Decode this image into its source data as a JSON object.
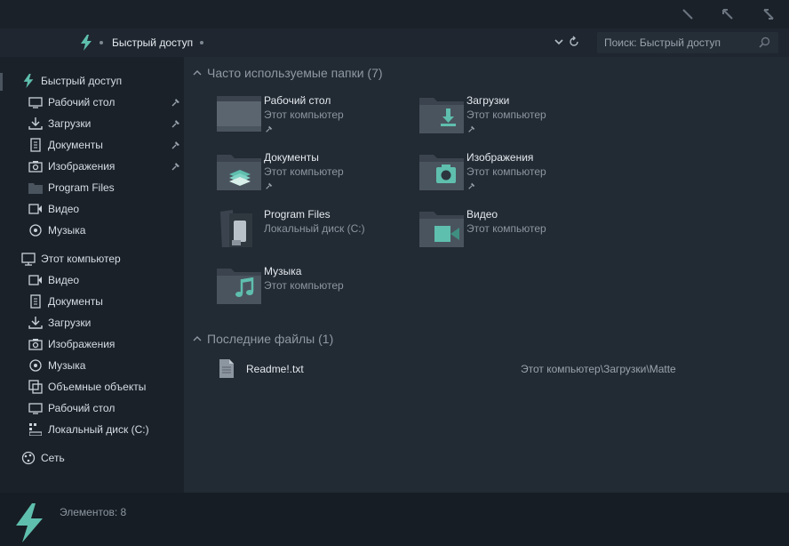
{
  "colors": {
    "accent": "#5fbfae",
    "folder": "#3b444e",
    "folder_front": "#4a545f",
    "background": "#1b2129",
    "main_pane": "#222a33",
    "status_bar": "#171d24"
  },
  "address_bar": {
    "breadcrumb": "Быстрый доступ",
    "search_placeholder": "Поиск: Быстрый доступ"
  },
  "window_controls": [
    "minimize-icon",
    "maximize-icon",
    "close-icon"
  ],
  "sidebar": {
    "quick_access": {
      "label": "Быстрый доступ",
      "icon": "bolt-icon",
      "items": [
        {
          "label": "Рабочий стол",
          "icon": "desktop-icon",
          "pinned": true
        },
        {
          "label": "Загрузки",
          "icon": "download-icon",
          "pinned": true
        },
        {
          "label": "Документы",
          "icon": "document-icon",
          "pinned": true
        },
        {
          "label": "Изображения",
          "icon": "image-icon",
          "pinned": true
        },
        {
          "label": "Program Files",
          "icon": "folder-icon",
          "pinned": false
        },
        {
          "label": "Видео",
          "icon": "video-icon",
          "pinned": false
        },
        {
          "label": "Музыка",
          "icon": "music-icon",
          "pinned": false
        }
      ]
    },
    "this_pc": {
      "label": "Этот компьютер",
      "icon": "computer-icon",
      "items": [
        {
          "label": "Видео",
          "icon": "video-icon"
        },
        {
          "label": "Документы",
          "icon": "document-icon"
        },
        {
          "label": "Загрузки",
          "icon": "download-icon"
        },
        {
          "label": "Изображения",
          "icon": "image-icon"
        },
        {
          "label": "Музыка",
          "icon": "music-icon"
        },
        {
          "label": "Объемные объекты",
          "icon": "3d-objects-icon"
        },
        {
          "label": "Рабочий стол",
          "icon": "desktop-icon"
        },
        {
          "label": "Локальный диск (C:)",
          "icon": "drive-icon"
        }
      ]
    },
    "network": {
      "label": "Сеть",
      "icon": "network-icon"
    }
  },
  "main": {
    "frequent": {
      "header": "Часто используемые папки (7)",
      "folders": [
        {
          "name": "Рабочий стол",
          "location": "Этот компьютер",
          "pinned": true,
          "icon": "desktop-folder-icon"
        },
        {
          "name": "Загрузки",
          "location": "Этот компьютер",
          "pinned": true,
          "icon": "downloads-folder-icon"
        },
        {
          "name": "Документы",
          "location": "Этот компьютер",
          "pinned": true,
          "icon": "documents-folder-icon"
        },
        {
          "name": "Изображения",
          "location": "Этот компьютер",
          "pinned": true,
          "icon": "pictures-folder-icon"
        },
        {
          "name": "Program Files",
          "location": "Локальный диск (C:)",
          "pinned": false,
          "icon": "program-files-folder-icon"
        },
        {
          "name": "Видео",
          "location": "Этот компьютер",
          "pinned": false,
          "icon": "videos-folder-icon"
        },
        {
          "name": "Музыка",
          "location": "Этот компьютер",
          "pinned": false,
          "icon": "music-folder-icon"
        }
      ]
    },
    "recent": {
      "header": "Последние файлы (1)",
      "files": [
        {
          "name": "Readme!.txt",
          "path": "Этот компьютер\\Загрузки\\Matte",
          "icon": "text-file-icon"
        }
      ]
    }
  },
  "status_bar": {
    "items_count": "Элементов: 8"
  }
}
